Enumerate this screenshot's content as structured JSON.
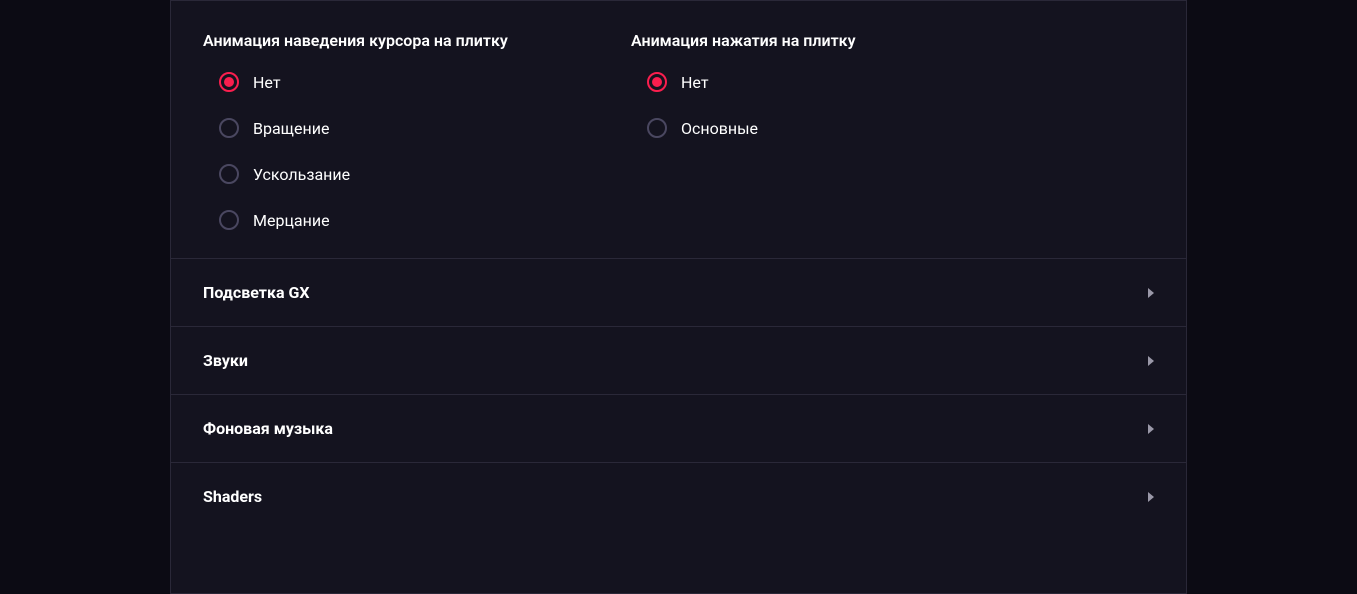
{
  "animations": {
    "hover": {
      "title": "Анимация наведения курсора на плитку",
      "options": [
        {
          "label": "Нет",
          "selected": true
        },
        {
          "label": "Вращение",
          "selected": false
        },
        {
          "label": "Ускользание",
          "selected": false
        },
        {
          "label": "Мерцание",
          "selected": false
        }
      ]
    },
    "click": {
      "title": "Анимация нажатия на плитку",
      "options": [
        {
          "label": "Нет",
          "selected": true
        },
        {
          "label": "Основные",
          "selected": false
        }
      ]
    }
  },
  "sections": [
    {
      "label": "Подсветка GX"
    },
    {
      "label": "Звуки"
    },
    {
      "label": "Фоновая музыка"
    },
    {
      "label": "Shaders"
    }
  ]
}
